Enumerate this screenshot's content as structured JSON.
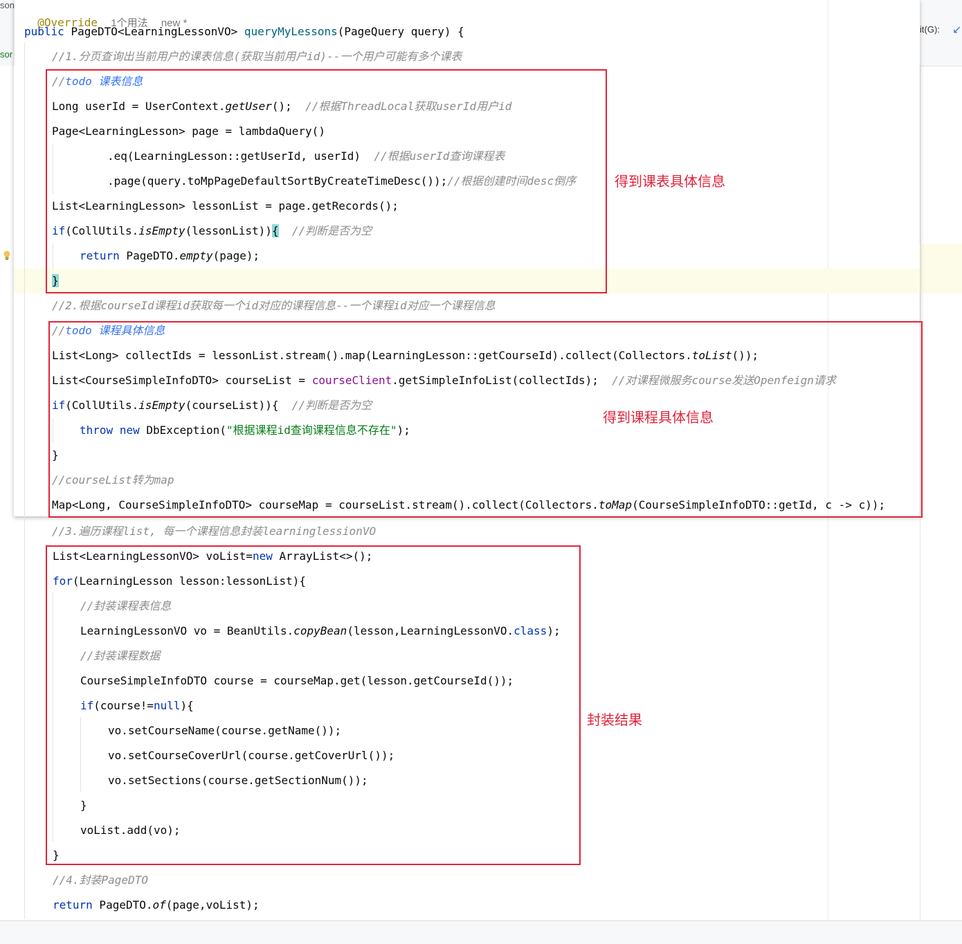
{
  "side_panels": {
    "top_left_label": "son",
    "left_label": "sor",
    "right_label": "it(G):"
  },
  "editor": {
    "header": {
      "annotation": "@Override",
      "usages": "1个用法",
      "new_label": "new *"
    },
    "signature": {
      "kw_public": "public",
      "return_type": "PageDTO<LearningLessonVO>",
      "method_name": "queryMyLessons",
      "params": "(PageQuery query) {"
    },
    "comments": {
      "step1": "//1.分页查询出当前用户的课表信息(获取当前用户id)--一个用户可能有多个课表",
      "step2": "//2.根据courseId课程id获取每一个id对应的课程信息--一个课程id对应一个课程信息",
      "step3": "//3.遍历课程list, 每一个课程信息封装learninglessionVO",
      "step4": "//4.封装PageDTO"
    },
    "block1": {
      "todo_prefix": "//",
      "todo_kw": "todo",
      "todo_text": " 课表信息",
      "l_userid": "Long userId = UserContext.",
      "l_userid_m": "getUser",
      "l_userid_end": "();  ",
      "l_userid_cm": "//根据ThreadLocal获取userId用户id",
      "l_page": "Page<LearningLesson> page = lambdaQuery()",
      "l_eq": ".eq(LearningLesson::getUserId, userId)  ",
      "l_eq_cm": "//根据userId查询课程表",
      "l_pg": ".page(query.toMpPageDefaultSortByCreateTimeDesc());",
      "l_pg_cm": "//根据创建时间desc倒序",
      "l_list": "List<LearningLesson> lessonList = page.getRecords();",
      "l_if_kw": "if",
      "l_if_a": "(CollUtils.",
      "l_if_m": "isEmpty",
      "l_if_b": "(lessonList))",
      "l_if_brace": "{",
      "l_if_cm": "  //判断是否为空",
      "l_ret_kw": "return",
      "l_ret_a": " PageDTO.",
      "l_ret_m": "empty",
      "l_ret_b": "(page);",
      "l_close": "}"
    },
    "block2": {
      "todo_prefix": "//",
      "todo_kw": "todo",
      "todo_text": " 课程具体信息",
      "l_ids_a": "List<Long> collectIds = lessonList.stream().map(LearningLesson::getCourseId).collect(Collectors.",
      "l_ids_m": "toList",
      "l_ids_b": "());",
      "l_cl_a": "List<CourseSimpleInfoDTO> courseList = ",
      "l_cl_f": "courseClient",
      "l_cl_b": ".getSimpleInfoList(collectIds);  ",
      "l_cl_cm": "//对课程微服务course发送Openfeign请求",
      "l_if_kw": "if",
      "l_if_a": "(CollUtils.",
      "l_if_m": "isEmpty",
      "l_if_b": "(courseList)){  ",
      "l_if_cm": "//判断是否为空",
      "l_throw_kw": "throw",
      "l_new_kw": "new",
      "l_throw_a": " DbException(",
      "l_throw_s": "\"根据课程id查询课程信息不存在\"",
      "l_throw_b": ");",
      "l_close": "}",
      "l_map_cm": "//courseList转为map",
      "l_map_a": "Map<Long, CourseSimpleInfoDTO> courseMap = courseList.stream().collect(Collectors.",
      "l_map_m": "toMap",
      "l_map_b": "(CourseSimpleInfoDTO::getId, c -> c));"
    },
    "block3": {
      "l_vo_a": "List<LearningLessonVO> voList=",
      "l_vo_kw": "new",
      "l_vo_b": " ArrayList<>();",
      "l_for_kw": "for",
      "l_for_b": "(LearningLesson lesson:lessonList){",
      "l_cm1": "//封装课程表信息",
      "l_copy_a": "LearningLessonVO vo = BeanUtils.",
      "l_copy_m": "copyBean",
      "l_copy_b": "(lesson,LearningLessonVO.",
      "l_copy_kw": "class",
      "l_copy_c": ");",
      "l_cm2": "//封装课程数据",
      "l_course": "CourseSimpleInfoDTO course = courseMap.get(lesson.getCourseId());",
      "l_if_kw": "if",
      "l_if_a": "(course!=",
      "l_if_null": "null",
      "l_if_b": "){",
      "l_s1": "vo.setCourseName(course.getName());",
      "l_s2": "vo.setCourseCoverUrl(course.getCoverUrl());",
      "l_s3": "vo.setSections(course.getSectionNum());",
      "l_close_inner": "}",
      "l_add": "voList.add(vo);",
      "l_close": "}"
    },
    "final": {
      "ret_kw": "return",
      "ret_a": " PageDTO.",
      "ret_m": "of",
      "ret_b": "(page,voList);"
    }
  },
  "annotations": {
    "label1": "得到课表具体信息",
    "label2": "得到课程具体信息",
    "label3": "封装结果",
    "box_color": "#e0243a"
  }
}
